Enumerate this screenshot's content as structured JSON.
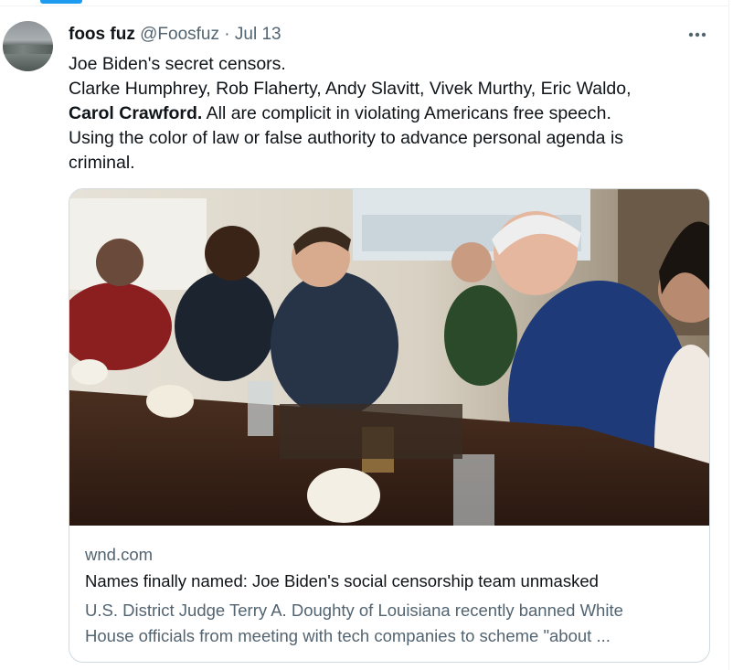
{
  "tweet": {
    "display_name": "foos fuz",
    "handle": "@Foosfuz",
    "separator": "·",
    "date": "Jul 13",
    "text_line1": "Joe Biden's secret censors.",
    "text_line2": "Clarke Humphrey, Rob Flaherty, Andy Slavitt, Vivek Murthy, Eric Waldo,",
    "text_line3_bold": "Carol Crawford.",
    "text_line3_rest": " All are complicit in violating Americans free speech.",
    "text_line4": "Using the color of law or false authority to advance personal agenda is",
    "text_line5": "criminal."
  },
  "card": {
    "domain": "wnd.com",
    "title": "Names finally named: Joe Biden's social censorship team unmasked",
    "desc_line1": "U.S. District Judge Terry A. Doughty of Louisiana recently banned White",
    "desc_line2": "House officials from meeting with tech companies to scheme \"about ..."
  },
  "icons": {
    "more": "more-horizontal-icon"
  },
  "colors": {
    "accent": "#1d9bf0",
    "text_primary": "#0f1419",
    "text_secondary": "#536471",
    "border": "#cfd9de"
  }
}
